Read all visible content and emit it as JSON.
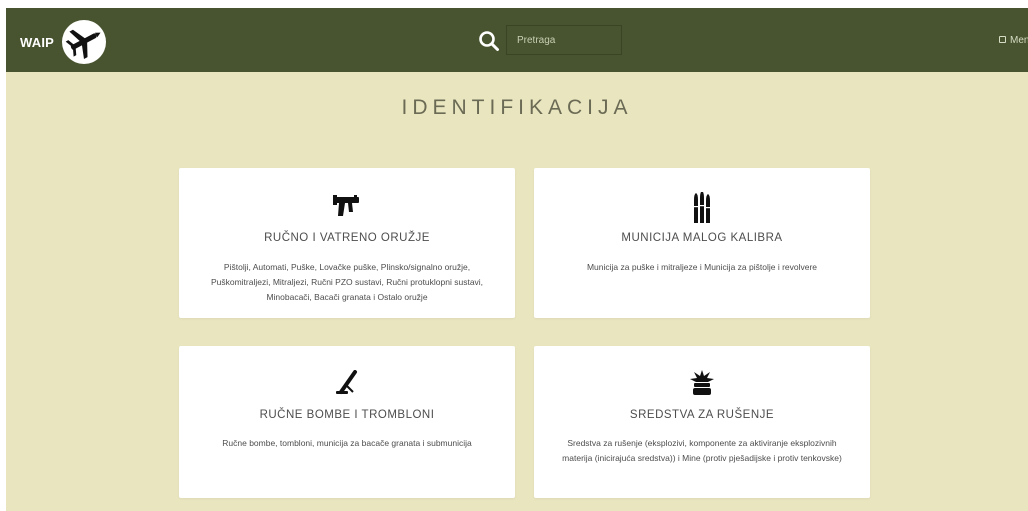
{
  "header": {
    "brand": "WAIP",
    "logo_icon": "aircraft-silhouette-icon",
    "search_placeholder": "Pretraga",
    "search_icon": "search-icon",
    "menu_label": "Men",
    "menu_icon": "menu-icon",
    "bg_color": "#47542f"
  },
  "page": {
    "title": "IDENTIFIKACIJA",
    "bg_color": "#e8e5bf"
  },
  "cards": [
    {
      "icon": "submachine-gun-icon",
      "title": "RUČNO I VATRENO ORUŽJE",
      "description": "Pištolji, Automati, Puške, Lovačke puške, Plinsko/signalno oružje, Puškomitraljezi, Mitraljezi, Ručni PZO sustavi, Ručni protuklopni sustavi, Minobacači, Bacači granata i Ostalo oružje"
    },
    {
      "icon": "ammunition-icon",
      "title": "MUNICIJA MALOG KALIBRA",
      "description": "Municija za puške i mitraljeze i Municija za pištolje i revolvere"
    },
    {
      "icon": "mortar-icon",
      "title": "RUČNE BOMBE I TROMBLONI",
      "description": "Ručne bombe, tombloni, municija za bacače granata i submunicija"
    },
    {
      "icon": "explosion-icon",
      "title": "SREDSTVA ZA RUŠENJE",
      "description": "Sredstva za rušenje (eksplozivi, komponente za aktiviranje eksplozivnih materija (inicirajuća sredstva)) i Mine (protiv pješadijske i protiv tenkovske)"
    }
  ]
}
